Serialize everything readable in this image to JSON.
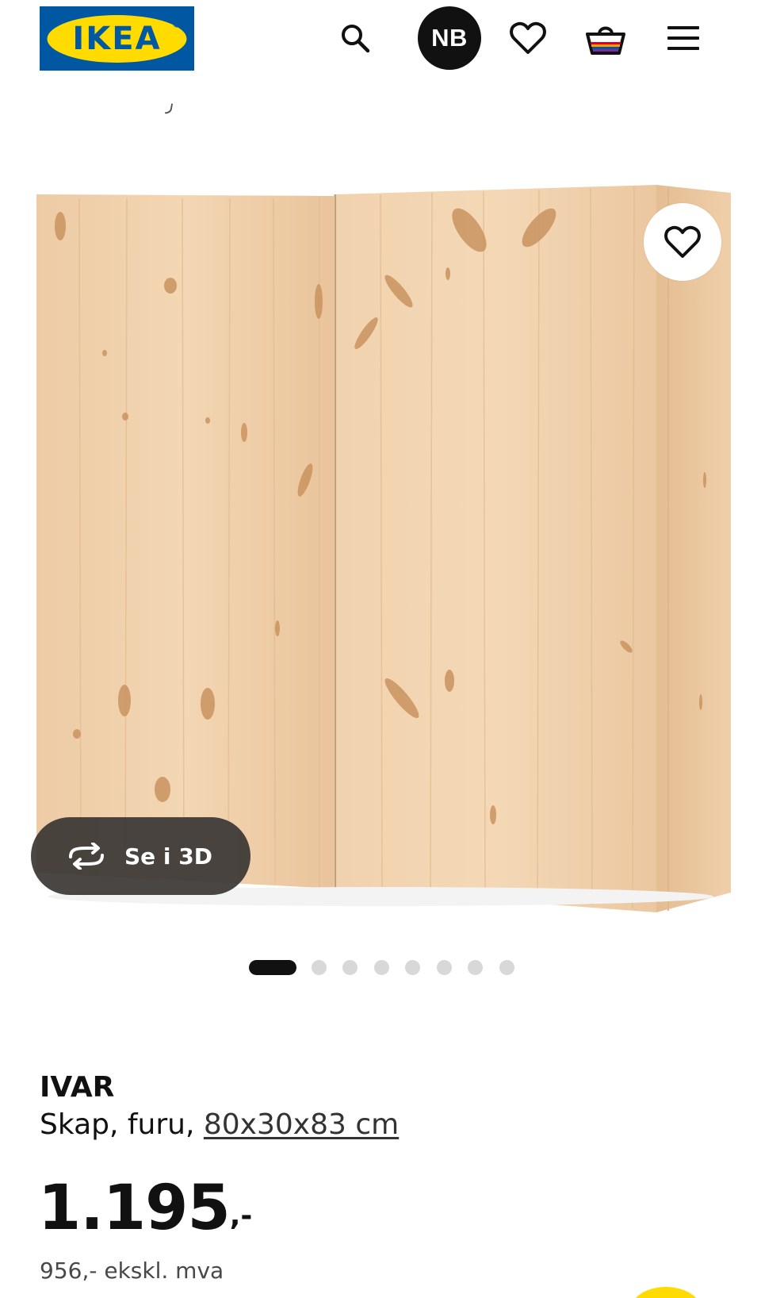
{
  "header": {
    "logo_text": "IKEA",
    "logo_colors": {
      "background": "#0058a3",
      "oval": "#ffdb00",
      "text": "#0058a3"
    },
    "language_label": "NB",
    "icons": [
      "search-icon",
      "heart-icon",
      "basket-icon",
      "menu-icon"
    ]
  },
  "gallery": {
    "view_3d_label": "Se i 3D",
    "slide_count": 8,
    "active_slide": 1
  },
  "product": {
    "name": "IVAR",
    "description": "Skap, furu,",
    "measurement": "80x30x83 cm",
    "price_main": "1.195",
    "price_suffix": ",-",
    "price_ex_vat": "956,- ekskl. mva"
  },
  "colors": {
    "brand_blue": "#0058a3",
    "brand_yellow": "#ffdb00",
    "dark": "#111111",
    "wood": "#ecc9a2"
  }
}
